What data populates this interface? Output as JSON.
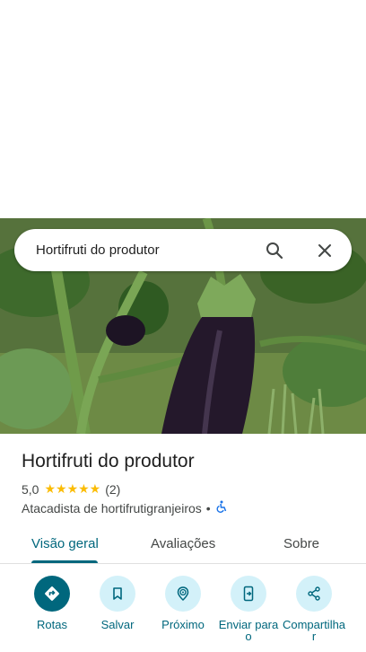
{
  "search": {
    "query": "Hortifruti do produtor"
  },
  "place": {
    "name": "Hortifruti do produtor",
    "rating": "5,0",
    "stars": "★★★★★",
    "review_count": "(2)",
    "category": "Atacadista de hortifrutigranjeiros",
    "separator": "•",
    "accessibility_icon": "wheelchair-icon"
  },
  "tabs": [
    {
      "label": "Visão geral",
      "active": true
    },
    {
      "label": "Avaliações",
      "active": false
    },
    {
      "label": "Sobre",
      "active": false
    }
  ],
  "actions": [
    {
      "label": "Rotas",
      "icon": "directions-icon"
    },
    {
      "label": "Salvar",
      "icon": "bookmark-icon"
    },
    {
      "label": "Próximo",
      "icon": "nearby-icon"
    },
    {
      "label": "Enviar para o",
      "icon": "send-to-phone-icon"
    },
    {
      "label": "Compartilha r",
      "icon": "share-icon"
    }
  ],
  "colors": {
    "accent": "#00677d",
    "accent_light": "#d3f1f9",
    "star": "#fbbc04"
  }
}
